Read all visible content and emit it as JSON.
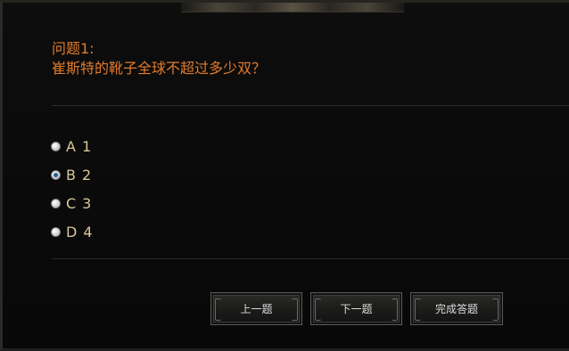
{
  "question": {
    "number_label": "问题1:",
    "text": "崔斯特的靴子全球不超过多少双？"
  },
  "options": [
    {
      "letter": "A",
      "value": "1",
      "checked": false
    },
    {
      "letter": "B",
      "value": "2",
      "checked": true
    },
    {
      "letter": "C",
      "value": "3",
      "checked": false
    },
    {
      "letter": "D",
      "value": "4",
      "checked": false
    }
  ],
  "buttons": {
    "prev": "上一题",
    "next": "下一题",
    "finish": "完成答题"
  }
}
